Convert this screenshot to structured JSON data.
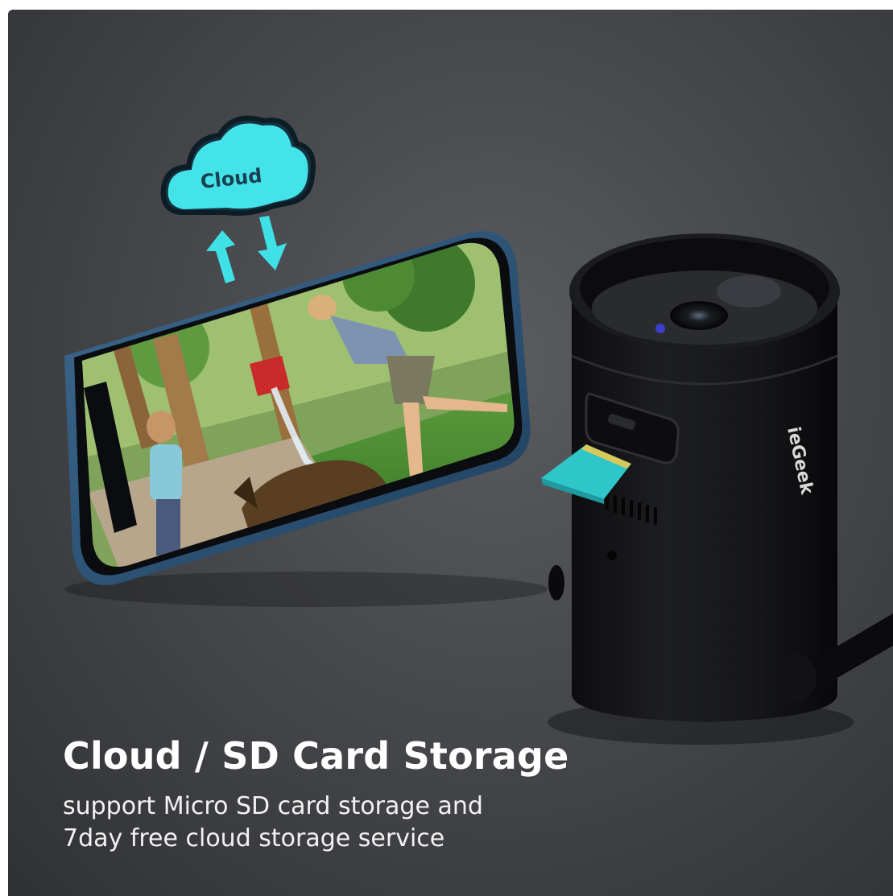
{
  "product": {
    "cloud_label": "Cloud",
    "brand_label": "ieGeek"
  },
  "caption": {
    "title": "Cloud / SD Card Storage",
    "line1": "support Micro SD card storage and",
    "line2": "7day free cloud storage service"
  },
  "colors": {
    "accent": "#3fe0e6",
    "sd_card": "#2fc6c9",
    "background": "#4a4c50",
    "camera_body": "#141416"
  },
  "icons": {
    "upload": "arrow-up-icon",
    "download": "arrow-down-icon",
    "cloud": "cloud-icon"
  }
}
